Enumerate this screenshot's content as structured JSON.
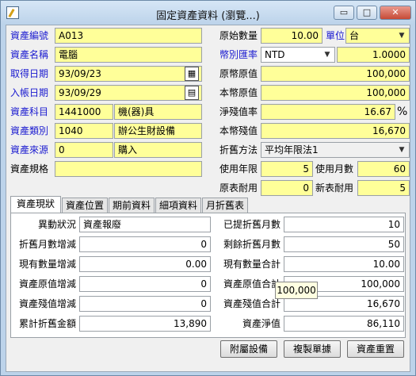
{
  "window": {
    "title": "固定資產資料 (瀏覽...)",
    "minimize_glyph": "▭",
    "maximize_glyph": "□",
    "close_glyph": "✕"
  },
  "form_left": {
    "asset_no": {
      "label": "資產編號",
      "value": "A013"
    },
    "asset_name": {
      "label": "資產名稱",
      "value": "電腦"
    },
    "acquire_date": {
      "label": "取得日期",
      "value": "93/09/23"
    },
    "entry_date": {
      "label": "入帳日期",
      "value": "93/09/29"
    },
    "subject": {
      "label": "資產科目",
      "code": "1441000",
      "name": "機(器)具"
    },
    "category": {
      "label": "資產類別",
      "code": "1040",
      "name": "辦公生財設備"
    },
    "source": {
      "label": "資產來源",
      "code": "0",
      "name": "購入"
    },
    "spec": {
      "label": "資產規格",
      "value": ""
    }
  },
  "form_right": {
    "orig_qty": {
      "label": "原始數量",
      "value": "10.00"
    },
    "unit": {
      "label": "單位",
      "value": "台"
    },
    "currency": {
      "label": "幣別匯率",
      "value": "NTD",
      "rate": "1.0000"
    },
    "orig_cost_fc": {
      "label": "原幣原值",
      "value": "100,000"
    },
    "orig_cost_local": {
      "label": "本幣原值",
      "value": "100,000"
    },
    "salvage_rate": {
      "label": "淨殘值率",
      "value": "16.67",
      "unit": "%"
    },
    "salvage_local": {
      "label": "本幣殘值",
      "value": "16,670"
    },
    "depr_method": {
      "label": "折舊方法",
      "value": "平均年限法1"
    },
    "life_years": {
      "label": "使用年限",
      "value": "5"
    },
    "life_months": {
      "label": "使用月數",
      "value": "60"
    },
    "orig_life": {
      "label": "原表耐用",
      "value": "0"
    },
    "new_life": {
      "label": "新表耐用",
      "value": "5"
    }
  },
  "tabs": [
    "資產現狀",
    "資產位置",
    "期前資料",
    "細項資料",
    "月折舊表"
  ],
  "status_panel": {
    "change_status": {
      "label": "異動狀況",
      "value": "資產報廢"
    },
    "depr_months_done": {
      "label": "已提折舊月數",
      "value": "10"
    },
    "depr_months_adj": {
      "label": "折舊月數增減",
      "value": "0"
    },
    "depr_months_left": {
      "label": "剩餘折舊月數",
      "value": "50"
    },
    "qty_adj": {
      "label": "現有數量增減",
      "value": "0.00"
    },
    "qty_total": {
      "label": "現有數量合計",
      "value": "10.00"
    },
    "cost_adj": {
      "label": "資產原值增減",
      "value": "0"
    },
    "cost_total": {
      "label": "資產原值合計",
      "value": "100,000"
    },
    "salvage_adj": {
      "label": "資產殘值增減",
      "value": "0"
    },
    "salvage_total": {
      "label": "資產殘值合計",
      "value": "16,670"
    },
    "accum_depr": {
      "label": "累計折舊金額",
      "value": "13,890"
    },
    "net_value": {
      "label": "資產淨值",
      "value": "86,110"
    }
  },
  "tooltip": "100,000",
  "buttons": {
    "attach": "附屬設備",
    "copy": "複製單據",
    "reset": "資產重置"
  }
}
